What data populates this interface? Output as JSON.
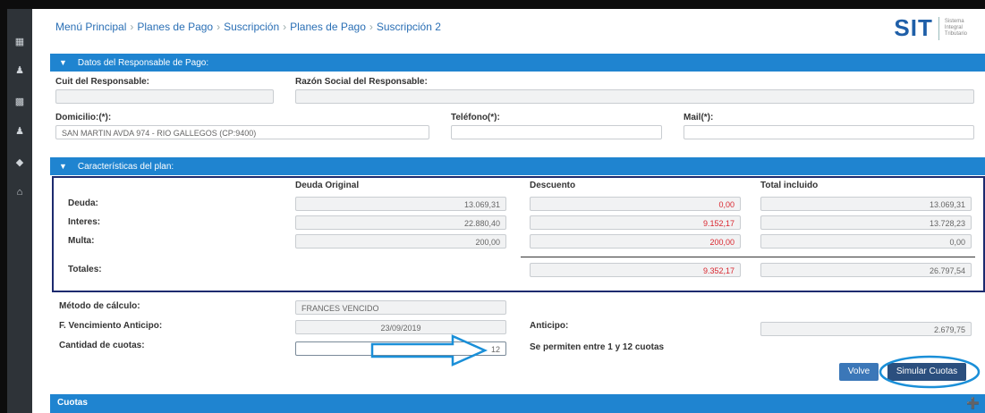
{
  "breadcrumb": [
    "Menú Principal",
    "Planes de Pago",
    "Suscripción",
    "Planes de Pago",
    "Suscripción 2"
  ],
  "logo": {
    "text": "SIT",
    "subtitle_lines": [
      "Sistema",
      "Integral",
      "Tributario"
    ]
  },
  "sidebar_icons": [
    "grid-icon",
    "user-icon",
    "calculator-icon",
    "person-icon",
    "badge-icon",
    "home-icon"
  ],
  "responsable": {
    "title": "Datos del Responsable de Pago:",
    "cuit_label": "Cuit del Responsable:",
    "cuit_value": "",
    "razon_label": "Razón Social del Responsable:",
    "razon_value": "",
    "domicilio_label": "Domicilio:(*):",
    "domicilio_value": "SAN MARTIN AVDA 974 - RIO GALLEGOS (CP:9400)",
    "telefono_label": "Teléfono(*):",
    "telefono_value": "",
    "mail_label": "Mail(*):",
    "mail_value": ""
  },
  "plan": {
    "title": "Características del plan:",
    "col_original": "Deuda Original",
    "col_descuento": "Descuento",
    "col_total": "Total incluido",
    "rows": [
      {
        "label": "Deuda:",
        "original": "13.069,31",
        "descuento": "0,00",
        "total": "13.069,31"
      },
      {
        "label": "Interes:",
        "original": "22.880,40",
        "descuento": "9.152,17",
        "total": "13.728,23"
      },
      {
        "label": "Multa:",
        "original": "200,00",
        "descuento": "200,00",
        "total": "0,00"
      }
    ],
    "totales_label": "Totales:",
    "totales_descuento": "9.352,17",
    "totales_total": "26.797,54"
  },
  "calculo": {
    "metodo_label": "Método de cálculo:",
    "metodo_value": "FRANCES VENCIDO",
    "vencimiento_label": "F. Vencimiento Anticipo:",
    "vencimiento_value": "23/09/2019",
    "anticipo_label": "Anticipo:",
    "anticipo_value": "2.679,75",
    "cuotas_label": "Cantidad de cuotas:",
    "cuotas_value": "12",
    "cuotas_hint": "Se permiten entre 1 y 12 cuotas"
  },
  "buttons": {
    "volver": "Volve",
    "simular": "Simular Cuotas"
  },
  "cuotas_panel": {
    "title": "Cuotas"
  },
  "colors": {
    "accent": "#1f84d0",
    "red": "#d9262f",
    "sidebar": "#2e3338",
    "table_border": "#1c2a6e",
    "annotation": "#1a8fd8"
  }
}
